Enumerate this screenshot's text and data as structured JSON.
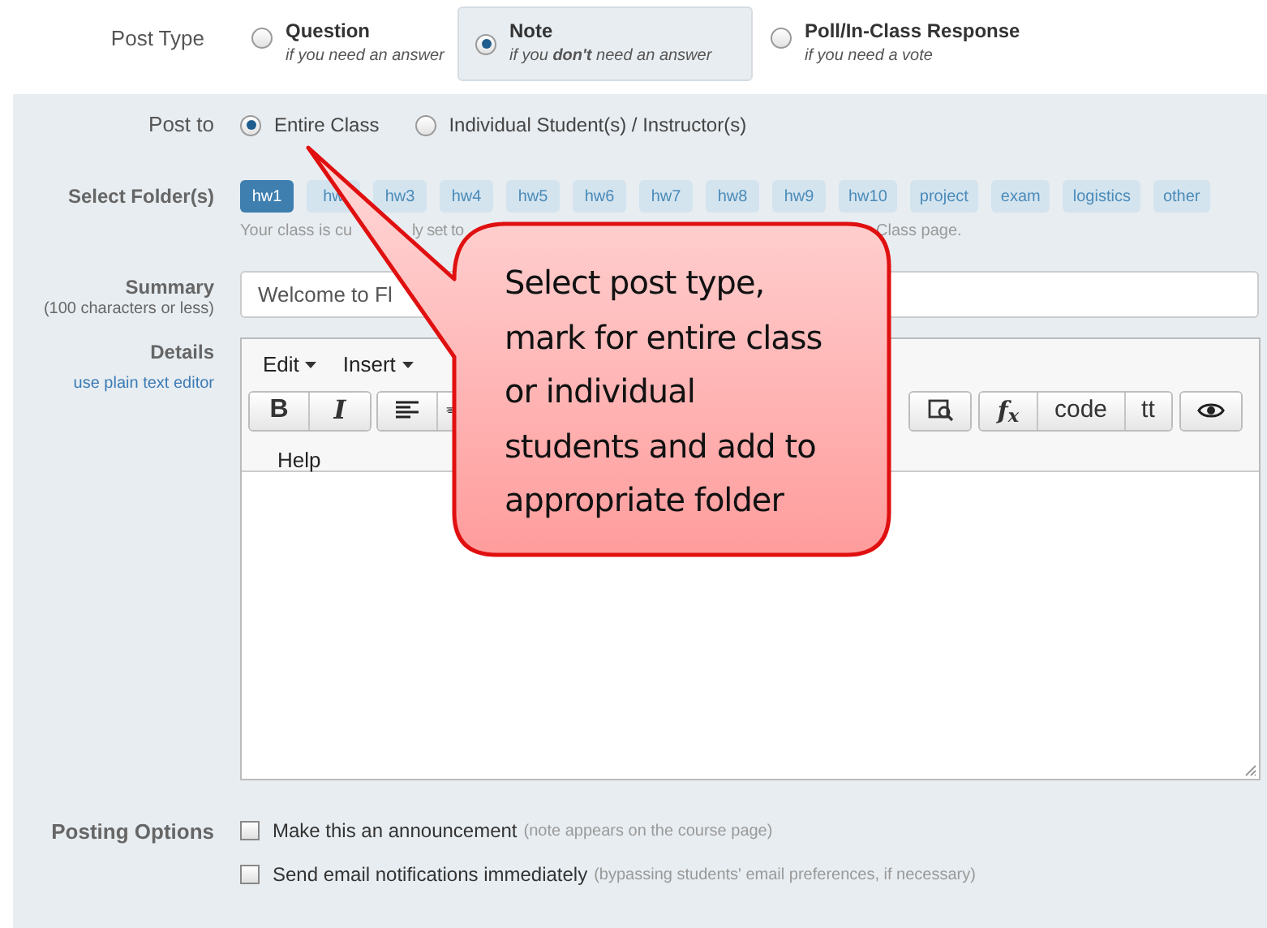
{
  "post_type": {
    "label": "Post Type",
    "options": [
      {
        "title": "Question",
        "subtitle": "if you need an answer",
        "selected": false
      },
      {
        "title": "Note",
        "subtitle": "if you **don't** need an answer",
        "selected": true
      },
      {
        "title": "Poll/In-Class Response",
        "subtitle": "if you need a vote",
        "selected": false
      }
    ]
  },
  "post_to": {
    "label": "Post to",
    "options": [
      {
        "label": "Entire Class",
        "selected": true
      },
      {
        "label": "Individual Student(s) / Instructor(s)",
        "selected": false
      }
    ]
  },
  "folders": {
    "label": "Select Folder(s)",
    "items": [
      {
        "label": "hw1",
        "selected": true
      },
      {
        "label": "hw",
        "selected": false
      },
      {
        "label": "hw3",
        "selected": false
      },
      {
        "label": "hw4",
        "selected": false
      },
      {
        "label": "hw5",
        "selected": false
      },
      {
        "label": "hw6",
        "selected": false
      },
      {
        "label": "hw7",
        "selected": false
      },
      {
        "label": "hw8",
        "selected": false
      },
      {
        "label": "hw9",
        "selected": false
      },
      {
        "label": "hw10",
        "selected": false
      },
      {
        "label": "project",
        "selected": false
      },
      {
        "label": "exam",
        "selected": false
      },
      {
        "label": "logistics",
        "selected": false
      },
      {
        "label": "other",
        "selected": false
      }
    ],
    "note_fragments": [
      "Your class is cu",
      "ly set to",
      "Class page."
    ]
  },
  "summary": {
    "label": "Summary",
    "hint": "(100 characters or less)",
    "value": "Welcome to Fl"
  },
  "details": {
    "label": "Details",
    "link": "use plain text editor",
    "menus": [
      "Edit",
      "Insert"
    ],
    "toolbar": [
      [
        {
          "kind": "bold",
          "label": "B"
        },
        {
          "kind": "italic",
          "label": "I"
        }
      ],
      [
        {
          "kind": "align-left"
        },
        {
          "kind": "align-center"
        }
      ],
      [
        {
          "kind": "find"
        }
      ],
      [
        {
          "kind": "formula",
          "label": "f$_{x}$"
        },
        {
          "kind": "text",
          "label": "code"
        },
        {
          "kind": "text",
          "label": "tt"
        }
      ],
      [
        {
          "kind": "preview"
        }
      ]
    ],
    "help": "Help"
  },
  "posting_options": {
    "label": "Posting Options",
    "items": [
      {
        "label": "Make this an announcement",
        "note": "(note appears on the course page)",
        "checked": false
      },
      {
        "label": "Send email notifications immediately",
        "note": "(bypassing students' email preferences, if necessary)",
        "checked": false
      }
    ]
  },
  "callout": {
    "lines": [
      "Select post type,",
      "mark for entire class",
      "or individual",
      "students and add to",
      "appropriate folder"
    ]
  }
}
